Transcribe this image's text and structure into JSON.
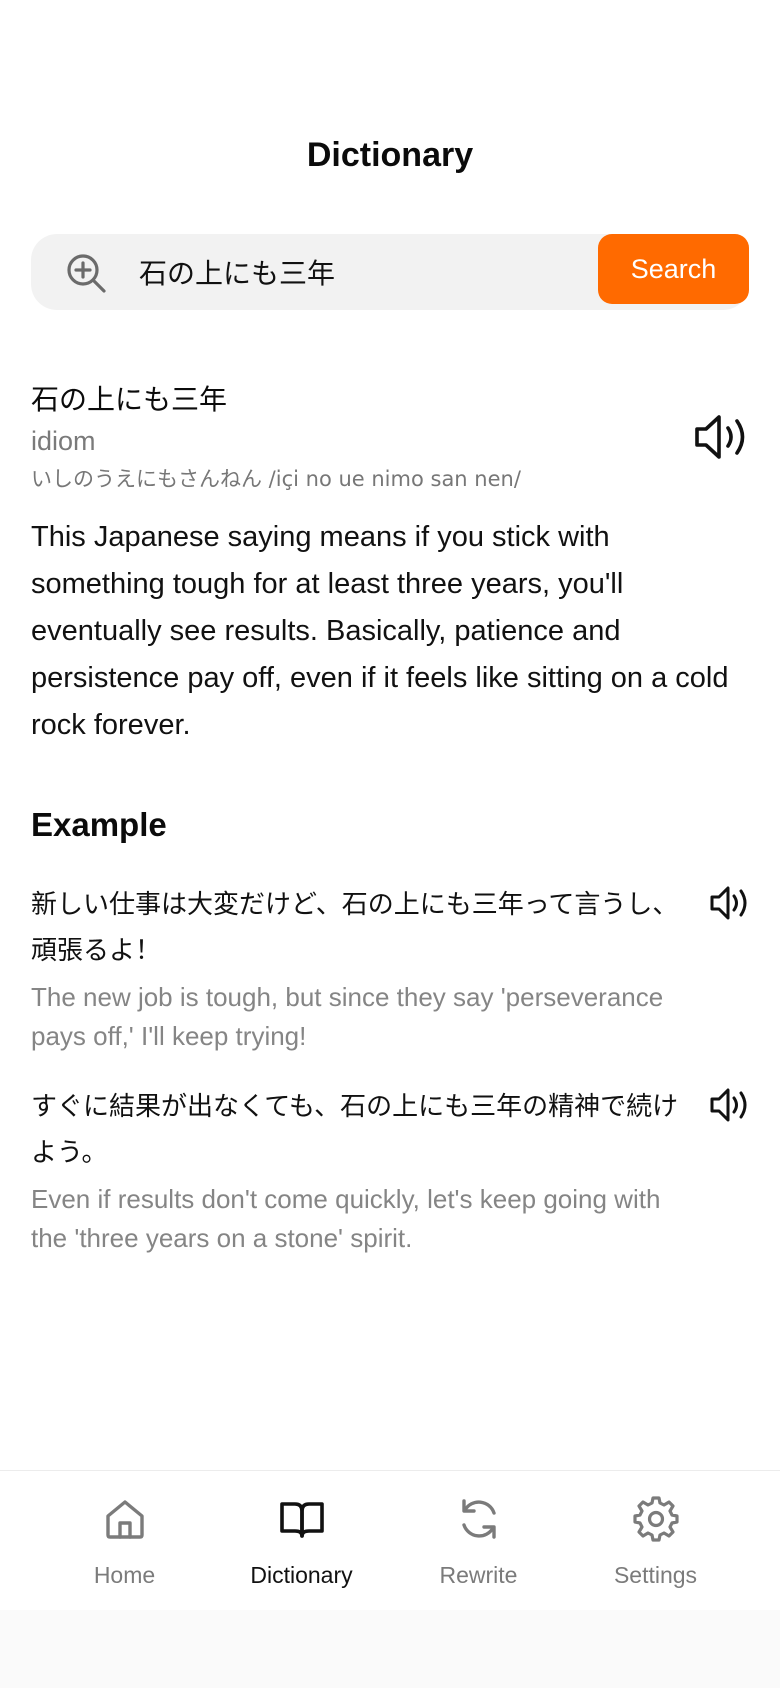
{
  "header": {
    "title": "Dictionary"
  },
  "search": {
    "value": "石の上にも三年",
    "button_label": "Search",
    "icon": "search-plus-icon"
  },
  "entry": {
    "term": "石の上にも三年",
    "part_of_speech": "idiom",
    "reading": "いしのうえにもさんねん /içi no ue nimo san nen/",
    "definition": "This Japanese saying means if you stick with something tough for at least three years, you'll eventually see results. Basically, patience and persistence pay off, even if it feels like sitting on a cold rock forever.",
    "audio_icon": "speaker-icon"
  },
  "examples_section": {
    "title": "Example",
    "items": [
      {
        "japanese": "新しい仕事は大変だけど、石の上にも三年って言うし、頑張るよ！",
        "english": "The new job is tough, but since they say 'perseverance pays off,' I'll keep trying!"
      },
      {
        "japanese": "すぐに結果が出なくても、石の上にも三年の精神で続けよう。",
        "english": "Even if results don't come quickly, let's keep going with the 'three years on a stone' spirit."
      }
    ]
  },
  "tab_bar": {
    "active": "Dictionary",
    "items": [
      {
        "label": "Home",
        "icon": "home-icon"
      },
      {
        "label": "Dictionary",
        "icon": "book-icon"
      },
      {
        "label": "Rewrite",
        "icon": "refresh-icon"
      },
      {
        "label": "Settings",
        "icon": "gear-icon"
      }
    ]
  },
  "colors": {
    "accent": "#ff6a00",
    "muted_text": "#7a7a7a",
    "search_bg": "#f2f2f2"
  }
}
